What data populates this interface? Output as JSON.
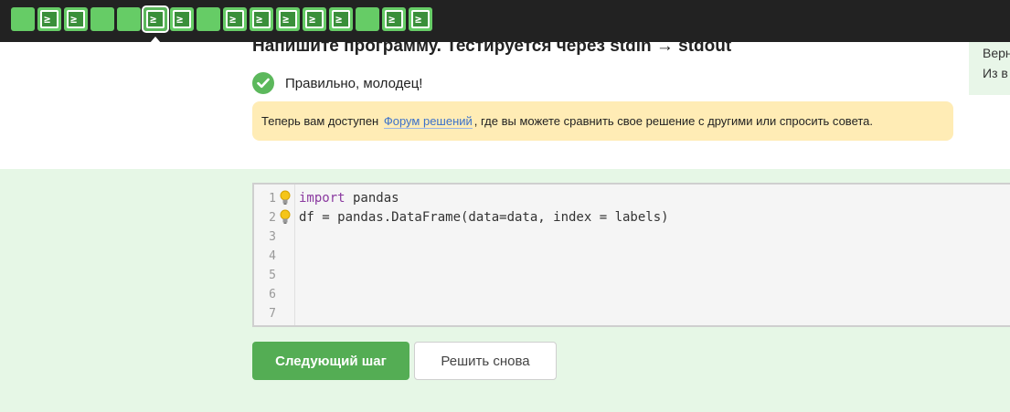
{
  "nav": {
    "steps": [
      {
        "type": "plain",
        "state": "passed"
      },
      {
        "type": "code",
        "state": "passed"
      },
      {
        "type": "code",
        "state": "passed"
      },
      {
        "type": "plain",
        "state": "passed"
      },
      {
        "type": "plain",
        "state": "passed"
      },
      {
        "type": "code",
        "state": "active"
      },
      {
        "type": "code",
        "state": "passed"
      },
      {
        "type": "plain",
        "state": "passed"
      },
      {
        "type": "code",
        "state": "passed"
      },
      {
        "type": "code",
        "state": "passed"
      },
      {
        "type": "code",
        "state": "passed"
      },
      {
        "type": "code",
        "state": "passed"
      },
      {
        "type": "code",
        "state": "passed"
      },
      {
        "type": "plain",
        "state": "passed"
      },
      {
        "type": "code",
        "state": "passed"
      },
      {
        "type": "code",
        "state": "passed"
      }
    ],
    "code_glyph": "≥",
    "accent_color": "#66cc66"
  },
  "task": {
    "title": "Напишите программу. Тестируется через stdin → stdout"
  },
  "side_panel": {
    "line1": "Верн",
    "line2": "Из в"
  },
  "result": {
    "icon": "checkmark-icon",
    "text": "Правильно, молодец!",
    "color": "#5cb85c"
  },
  "notice": {
    "before": "Теперь вам доступен",
    "link": "Форум решений",
    "after": ", где вы можете сравнить свое решение с другими или спросить совета."
  },
  "editor": {
    "lines": [
      {
        "num": "1",
        "hint": true,
        "kw": "import",
        "rest": " pandas"
      },
      {
        "num": "2",
        "hint": true,
        "kw": "",
        "rest": "df = pandas.DataFrame(data=data, index = labels)"
      },
      {
        "num": "3",
        "hint": false,
        "kw": "",
        "rest": ""
      },
      {
        "num": "4",
        "hint": false,
        "kw": "",
        "rest": ""
      },
      {
        "num": "5",
        "hint": false,
        "kw": "",
        "rest": ""
      },
      {
        "num": "6",
        "hint": false,
        "kw": "",
        "rest": ""
      },
      {
        "num": "7",
        "hint": false,
        "kw": "",
        "rest": ""
      }
    ]
  },
  "buttons": {
    "next": "Следующий шаг",
    "retry": "Решить снова"
  }
}
